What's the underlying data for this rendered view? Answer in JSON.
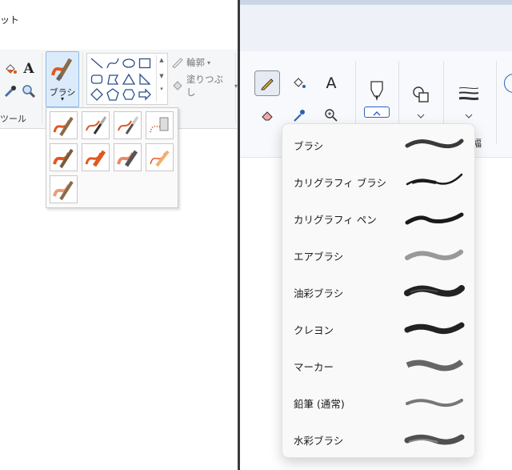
{
  "left": {
    "title_fragment": "ット",
    "group_tools_label": "ツール",
    "brush_button_label": "ブラシ",
    "brush_button_arrow": "▾",
    "outline_label": "輪郭",
    "fill_label": "塗りつぶし",
    "text_tool_glyph": "A"
  },
  "right": {
    "text_tool_glyph": "A",
    "size_label_fragment": "幅",
    "brush_menu": {
      "items": [
        {
          "label": "ブラシ"
        },
        {
          "label": "カリグラフィ ブラシ"
        },
        {
          "label": "カリグラフィ ペン"
        },
        {
          "label": "エアブラシ"
        },
        {
          "label": "油彩ブラシ"
        },
        {
          "label": "クレヨン"
        },
        {
          "label": "マーカー"
        },
        {
          "label": "鉛筆 (通常)"
        },
        {
          "label": "水彩ブラシ"
        }
      ]
    }
  },
  "colors": {
    "brush_orange": "#e2571e",
    "selection_blue": "#dcebfc",
    "dark_divider": "#3a3a3a"
  }
}
